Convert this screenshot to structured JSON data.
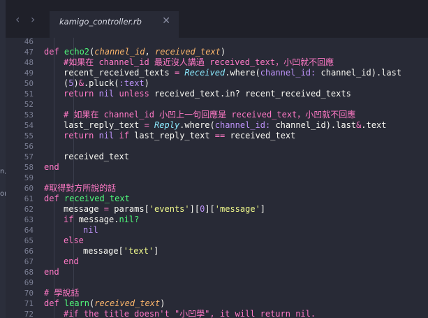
{
  "tab": {
    "title": "kamigo_controller.rb"
  },
  "icons": {
    "back": "chevron-left-icon",
    "forward": "chevron-right-icon",
    "close": "close-icon"
  },
  "sidebar": {
    "fragments": [
      "n,",
      "or"
    ]
  },
  "editor": {
    "lines": [
      {
        "n": "46",
        "tokens": []
      },
      {
        "n": "47",
        "tokens": [
          [
            "kw",
            "def "
          ],
          [
            "fn",
            "echo2"
          ],
          [
            "pl",
            "("
          ],
          [
            "param",
            "channel_id"
          ],
          [
            "pl",
            ", "
          ],
          [
            "param",
            "received_text"
          ],
          [
            "pl",
            ")"
          ]
        ],
        "indent": 1
      },
      {
        "n": "48",
        "tokens": [
          [
            "cmt",
            "#如果在 channel_id 最近沒人講過 received_text，小凹就不回應"
          ]
        ],
        "indent": 2
      },
      {
        "n": "49",
        "tokens": [
          [
            "pl",
            "recent_received_texts "
          ],
          [
            "kw",
            "= "
          ],
          [
            "const",
            "Received"
          ],
          [
            "pl",
            ".where("
          ],
          [
            "key",
            "channel_id:"
          ],
          [
            "pl",
            " channel_id).last"
          ]
        ],
        "indent": 2
      },
      {
        "n": "50",
        "tokens": [
          [
            "pl",
            "("
          ],
          [
            "sym",
            "5"
          ],
          [
            "pl",
            ")"
          ],
          [
            "kw",
            "&"
          ],
          [
            "pl",
            ".pluck("
          ],
          [
            "sym",
            ":text"
          ],
          [
            "pl",
            ")"
          ]
        ],
        "indent": 2
      },
      {
        "n": "51",
        "tokens": [
          [
            "kw",
            "return "
          ],
          [
            "sym",
            "nil "
          ],
          [
            "kw",
            "unless "
          ],
          [
            "pl",
            "received_text.in? recent_received_texts"
          ]
        ],
        "indent": 2
      },
      {
        "n": "52",
        "tokens": []
      },
      {
        "n": "53",
        "tokens": [
          [
            "cmt",
            "# 如果在 channel_id 小凹上一句回應是 received_text，小凹就不回應"
          ]
        ],
        "indent": 2
      },
      {
        "n": "54",
        "tokens": [
          [
            "pl",
            "last_reply_text "
          ],
          [
            "kw",
            "= "
          ],
          [
            "const",
            "Reply"
          ],
          [
            "pl",
            ".where("
          ],
          [
            "key",
            "channel_id:"
          ],
          [
            "pl",
            " channel_id).last"
          ],
          [
            "kw",
            "&"
          ],
          [
            "pl",
            ".text"
          ]
        ],
        "indent": 2
      },
      {
        "n": "55",
        "tokens": [
          [
            "kw",
            "return "
          ],
          [
            "sym",
            "nil "
          ],
          [
            "kw",
            "if "
          ],
          [
            "pl",
            "last_reply_text "
          ],
          [
            "kw",
            "== "
          ],
          [
            "pl",
            "received_text"
          ]
        ],
        "indent": 2
      },
      {
        "n": "56",
        "tokens": []
      },
      {
        "n": "57",
        "tokens": [
          [
            "pl",
            "received_text"
          ]
        ],
        "indent": 2
      },
      {
        "n": "58",
        "tokens": [
          [
            "kw",
            "end"
          ]
        ],
        "indent": 1
      },
      {
        "n": "59",
        "tokens": []
      },
      {
        "n": "60",
        "tokens": [
          [
            "cmt",
            "#取得對方所說的話"
          ]
        ],
        "indent": 1
      },
      {
        "n": "61",
        "tokens": [
          [
            "kw",
            "def "
          ],
          [
            "fn",
            "received_text"
          ]
        ],
        "indent": 1
      },
      {
        "n": "62",
        "tokens": [
          [
            "pl",
            "message "
          ],
          [
            "kw",
            "= "
          ],
          [
            "pl",
            "params["
          ],
          [
            "str",
            "'events'"
          ],
          [
            "pl",
            "]["
          ],
          [
            "sym",
            "0"
          ],
          [
            "pl",
            "]["
          ],
          [
            "str",
            "'message'"
          ],
          [
            "pl",
            "]"
          ]
        ],
        "indent": 2
      },
      {
        "n": "63",
        "tokens": [
          [
            "kw",
            "if "
          ],
          [
            "pl",
            "message."
          ],
          [
            "fn",
            "nil?"
          ]
        ],
        "indent": 2
      },
      {
        "n": "64",
        "tokens": [
          [
            "sym",
            "nil"
          ]
        ],
        "indent": 3
      },
      {
        "n": "65",
        "tokens": [
          [
            "kw",
            "else"
          ]
        ],
        "indent": 2
      },
      {
        "n": "66",
        "tokens": [
          [
            "pl",
            "message["
          ],
          [
            "str",
            "'text'"
          ],
          [
            "pl",
            "]"
          ]
        ],
        "indent": 3
      },
      {
        "n": "67",
        "tokens": [
          [
            "kw",
            "end"
          ]
        ],
        "indent": 2
      },
      {
        "n": "68",
        "tokens": [
          [
            "kw",
            "end"
          ]
        ],
        "indent": 1
      },
      {
        "n": "69",
        "tokens": []
      },
      {
        "n": "70",
        "tokens": [
          [
            "cmt",
            "# 學說話"
          ]
        ],
        "indent": 1
      },
      {
        "n": "71",
        "tokens": [
          [
            "kw",
            "def "
          ],
          [
            "fn",
            "learn"
          ],
          [
            "pl",
            "("
          ],
          [
            "param",
            "received_text"
          ],
          [
            "pl",
            ")"
          ]
        ],
        "indent": 1
      },
      {
        "n": "72",
        "tokens": [
          [
            "cmt",
            "#if the title doesn't \"小凹學\", it will return nil."
          ]
        ],
        "indent": 2
      }
    ]
  }
}
